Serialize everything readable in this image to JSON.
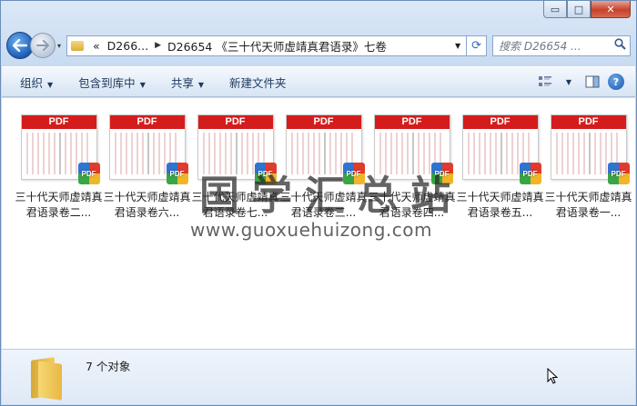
{
  "window": {
    "caption": {
      "minimize": "▭",
      "maximize": "□",
      "close": "✕"
    }
  },
  "nav": {
    "back_icon": "arrow-left-icon",
    "forward_icon": "arrow-right-icon",
    "recent_glyph": "▾"
  },
  "address": {
    "prefix": "«",
    "crumbs": [
      "D266...",
      "D26654 《三十代天师虚靖真君语录》七卷"
    ],
    "refresh_glyph": "⟳"
  },
  "search": {
    "placeholder": "搜索 D26654 ..."
  },
  "toolbar": {
    "organize": "组织",
    "include_in_library": "包含到库中",
    "share": "共享",
    "new_folder": "新建文件夹"
  },
  "files": [
    {
      "label": "三十代天师虚靖真君语录卷二..."
    },
    {
      "label": "三十代天师虚靖真君语录卷六..."
    },
    {
      "label": "三十代天师虚靖真君语录卷七..."
    },
    {
      "label": "三十代天师虚靖真君语录卷三..."
    },
    {
      "label": "三十代天师虚靖真君语录卷四..."
    },
    {
      "label": "三十代天师虚靖真君语录卷五..."
    },
    {
      "label": "三十代天师虚靖真君语录卷一..."
    }
  ],
  "thumb": {
    "banner": "PDF",
    "badge": "PDF"
  },
  "watermark": {
    "title": "国学汇总站",
    "url": "www.guoxuehuizong.com"
  },
  "details": {
    "count": "7 个对象"
  }
}
